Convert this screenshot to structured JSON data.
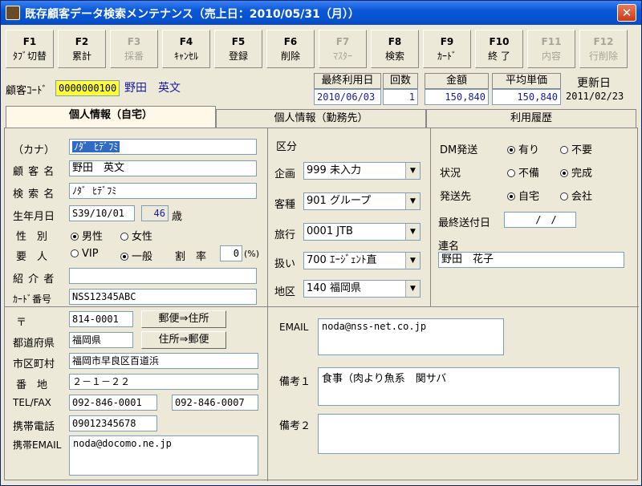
{
  "window": {
    "title": "既存顧客データ検索メンテナンス（売上日：2010/05/31（月））",
    "close_glyph": "✕"
  },
  "function_keys": [
    {
      "key": "F1",
      "label": "ﾀﾌﾞ切替",
      "enabled": true
    },
    {
      "key": "F2",
      "label": "累計",
      "enabled": true
    },
    {
      "key": "F3",
      "label": "採番",
      "enabled": false
    },
    {
      "key": "F4",
      "label": "ｷｬﾝｾﾙ",
      "enabled": true
    },
    {
      "key": "F5",
      "label": "登録",
      "enabled": true
    },
    {
      "key": "F6",
      "label": "削除",
      "enabled": true
    },
    {
      "key": "F7",
      "label": "ﾏｽﾀｰ",
      "enabled": false
    },
    {
      "key": "F8",
      "label": "検索",
      "enabled": true
    },
    {
      "key": "F9",
      "label": "ｶｰﾄﾞ",
      "enabled": true
    },
    {
      "key": "F10",
      "label": "終 了",
      "enabled": true
    },
    {
      "key": "F11",
      "label": "内容",
      "enabled": false
    },
    {
      "key": "F12",
      "label": "行削除",
      "enabled": false
    }
  ],
  "header": {
    "customer_code_label": "顧客ｺｰﾄﾞ",
    "customer_code": "0000000100",
    "customer_name": "野田　英文",
    "last_use_label": "最終利用日",
    "count_label": "回数",
    "amount_label": "金額",
    "avg_label": "平均単価",
    "update_label": "更新日",
    "last_use_date": "2010/06/03",
    "count": "1",
    "amount": "150,840",
    "avg": "150,840",
    "update_date": "2011/02/23"
  },
  "tabs": [
    {
      "label": "個人情報（自宅）",
      "active": true
    },
    {
      "label": "個人情報（勤務先）",
      "active": false
    },
    {
      "label": "利用履歴",
      "active": false
    }
  ],
  "personal": {
    "kana_label": "（カナ）",
    "kana": "ﾉﾀﾞ ﾋﾃﾞﾌﾐ",
    "name_label": "顧 客 名",
    "name": "野田　英文",
    "search_label": "検 索 名",
    "search": "ﾉﾀﾞ ﾋﾃﾞﾌﾐ",
    "birth_label": "生年月日",
    "birth": "S39/10/01",
    "age": "46",
    "age_unit": "歳",
    "gender_label": "性　別",
    "male": "男性",
    "female": "女性",
    "important_label": "要　人",
    "vip": "VIP",
    "general": "一般",
    "discount_label": "割　率",
    "discount": "0",
    "discount_unit": "(%)",
    "introducer_label": "紹 介 者",
    "introducer": "",
    "card_label": "ｶｰﾄﾞ番号",
    "card": "NSS12345ABC"
  },
  "category": {
    "section_label": "区分",
    "plan_label": "企画",
    "plan": "999 未入力",
    "type_label": "客種",
    "type": "901 グループ",
    "travel_label": "旅行",
    "travel": "0001 JTB",
    "handling_label": "扱い",
    "handling": "700 ｴｰｼﾞｪﾝﾄ直",
    "region_label": "地区",
    "region": "140 福岡県"
  },
  "dm": {
    "dm_label": "DM発送",
    "yes": "有り",
    "no": "不要",
    "status_label": "状況",
    "incomplete": "不備",
    "complete": "完成",
    "dest_label": "発送先",
    "home": "自宅",
    "company": "会社",
    "last_send_label": "最終送付日",
    "last_send": "　/　/",
    "joint_label": "連名",
    "joint": "野田　花子"
  },
  "address": {
    "zip_label": "〒",
    "zip": "814-0001",
    "zip_to_addr": "郵便⇒住所",
    "pref_label": "都道府県",
    "pref": "福岡県",
    "addr_to_zip": "住所⇒郵便",
    "city_label": "市区町村",
    "city": "福岡市早良区百道浜",
    "street_label": "番　地",
    "street": "２－１－２２",
    "tel_label": "TEL/FAX",
    "tel": "092-846-0001",
    "fax": "092-846-0007",
    "mobile_label": "携帯電話",
    "mobile": "09012345678",
    "mobile_email_label": "携帯EMAIL",
    "mobile_email": "noda@docomo.ne.jp"
  },
  "notes": {
    "email_label": "EMAIL",
    "email": "noda@nss-net.co.jp",
    "note1_label": "備考１",
    "note1": "食事（肉より魚系　関サバ",
    "note2_label": "備考２",
    "note2": ""
  }
}
